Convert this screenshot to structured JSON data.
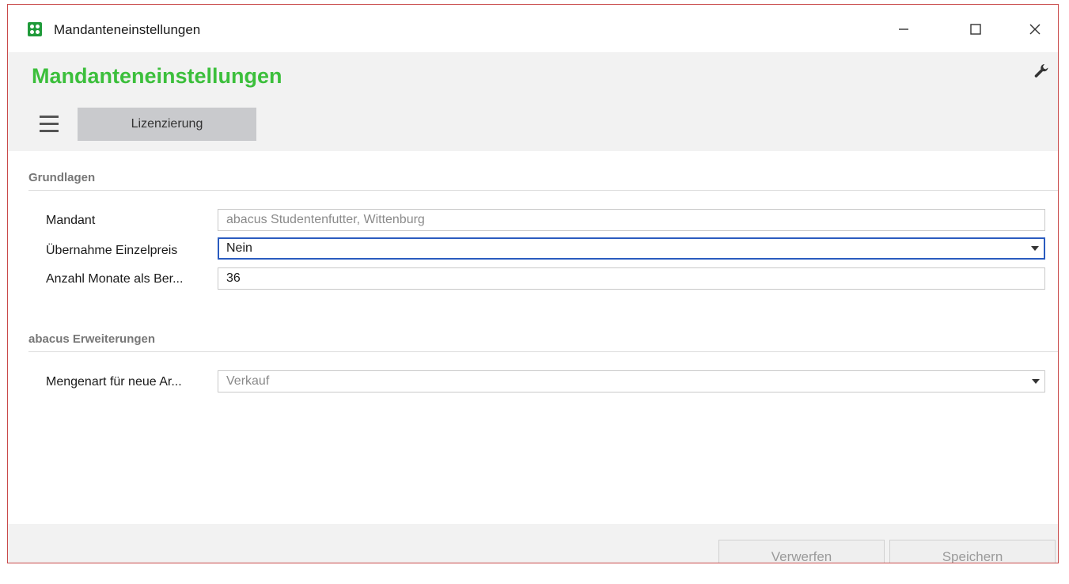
{
  "window": {
    "title": "Mandanteneinstellungen"
  },
  "header": {
    "title": "Mandanteneinstellungen",
    "tab_label": "Lizenzierung"
  },
  "sections": {
    "grundlagen": {
      "title": "Grundlagen",
      "mandant_label": "Mandant",
      "mandant_value": "abacus Studentenfutter, Wittenburg",
      "einzelpreis_label": "Übernahme Einzelpreis",
      "einzelpreis_value": "Nein",
      "monate_label": "Anzahl Monate als Ber...",
      "monate_value": "36"
    },
    "erweiterungen": {
      "title": "abacus Erweiterungen",
      "mengenart_label": "Mengenart für neue Ar...",
      "mengenart_value": "Verkauf"
    }
  },
  "footer": {
    "discard_label": "Verwerfen",
    "save_label": "Speichern"
  },
  "colors": {
    "accent_green": "#3cbf3c",
    "focus_blue": "#2a5bbf",
    "window_border": "#c94a4a"
  }
}
